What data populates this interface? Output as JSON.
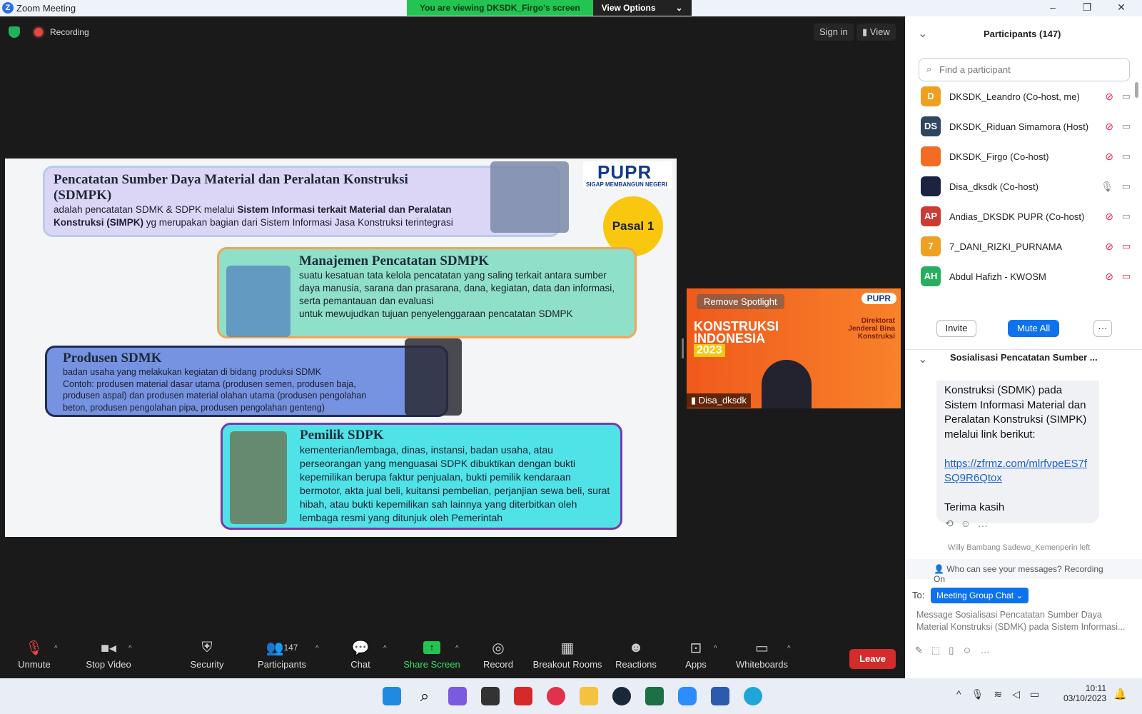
{
  "window": {
    "title": "Zoom Meeting",
    "banner": "You are viewing DKSDK_Firgo's screen",
    "view_options": "View Options"
  },
  "topbar": {
    "recording": "Recording",
    "sign_in": "Sign in",
    "view": "View"
  },
  "slide": {
    "logo": "PUPR",
    "logo_sub": "SIGAP MEMBANGUN NEGERI",
    "pasal": "Pasal 1",
    "title": "Pencatatan Sumber Daya Material dan Peralatan Konstruksi (SDMPK)",
    "title_body_pre": "adalah pencatatan SDMK & SDPK melalui ",
    "title_body_bold": "Sistem Informasi terkait Material dan Peralatan Konstruksi (SIMPK)",
    "title_body_post": " yg merupakan bagian dari Sistem Informasi Jasa Konstruksi terintegrasi",
    "manajemen_title": "Manajemen Pencatatan SDMPK",
    "manajemen_body": "suatu kesatuan tata kelola pencatatan yang saling terkait antara sumber daya manusia, sarana dan prasarana, dana, kegiatan, data dan informasi, serta pemantauan dan evaluasi",
    "manajemen_body2": "untuk mewujudkan tujuan penyelenggaraan pencatatan SDMPK",
    "produsen_title": "Produsen SDMK",
    "produsen_body": "badan usaha yang melakukan kegiatan di bidang produksi SDMK",
    "produsen_body2": "Contoh: produsen material dasar utama (produsen semen, produsen baja, produsen aspal) dan produsen material olahan utama (produsen pengolahan beton, produsen pengolahan pipa, produsen pengolahan genteng)",
    "pemilik_title": "Pemilik SDPK",
    "pemilik_body": "kementerian/lembaga, dinas, instansi, badan usaha, atau perseorangan yang menguasai SDPK dibuktikan dengan bukti kepemilikan berupa faktur penjualan, bukti pemilik kendaraan bermotor, akta jual beli, kuitansi pembelian, perjanjian sewa beli, surat hibah, atau bukti kepemilikan sah lainnya yang diterbitkan oleh lembaga resmi yang ditunjuk oleh Pemerintah"
  },
  "video": {
    "remove_spotlight": "Remove Spotlight",
    "name": "Disa_dksdk",
    "bg_title": "KONSTRUKSI INDONESIA",
    "bg_year": "2023",
    "bg_dir": "Direktorat Jenderal Bina Konstruksi",
    "bg_logo": "PUPR"
  },
  "toolbar": {
    "items": [
      "Unmute",
      "Stop Video",
      "Security",
      "Participants",
      "Chat",
      "Share Screen",
      "Record",
      "Breakout Rooms",
      "Reactions",
      "Apps",
      "Whiteboards"
    ],
    "participants_count": "147",
    "leave": "Leave"
  },
  "participants": {
    "title": "Participants (147)",
    "search_placeholder": "Find a participant",
    "list": [
      {
        "initials": "D",
        "name": "DKSDK_Leandro (Co-host, me)",
        "color": "#f0a020"
      },
      {
        "initials": "DS",
        "name": "DKSDK_Riduan Simamora (Host)",
        "color": "#2f4560"
      },
      {
        "initials": "",
        "name": "DKSDK_Firgo (Co-host)",
        "color": "#f36c23"
      },
      {
        "initials": "",
        "name": "Disa_dksdk (Co-host)",
        "color": "#1b2340"
      },
      {
        "initials": "AP",
        "name": "Andias_DKSDK PUPR (Co-host)",
        "color": "#cc3a35"
      },
      {
        "initials": "7",
        "name": "7_DANI_RIZKI_PURNAMA",
        "color": "#f0a020"
      },
      {
        "initials": "AH",
        "name": "Abdul Hafizh - KWOSM",
        "color": "#27ae60"
      }
    ],
    "invite": "Invite",
    "mute_all": "Mute All",
    "more": "···"
  },
  "chat": {
    "title": "Sosialisasi Pencatatan Sumber ...",
    "message": "Konstruksi (SDMK) pada Sistem Informasi Material dan Peralatan Konstruksi (SIMPK) melalui link berikut:",
    "link": "https://zfrmz.com/mlrfvpeES7fSQ9R6Qtox",
    "thanks": "Terima kasih",
    "system": "Willy Bambang Sadewo_Kemenperin left",
    "privacy": "Who can see your messages? Recording On",
    "to_label": "To:",
    "to_value": "Meeting Group Chat",
    "input_placeholder": "Message Sosialisasi Pencatatan Sumber Daya Material Konstruksi (SDMK) pada Sistem Informasi..."
  },
  "taskbar": {
    "time": "10:11",
    "date": "03/10/2023"
  }
}
